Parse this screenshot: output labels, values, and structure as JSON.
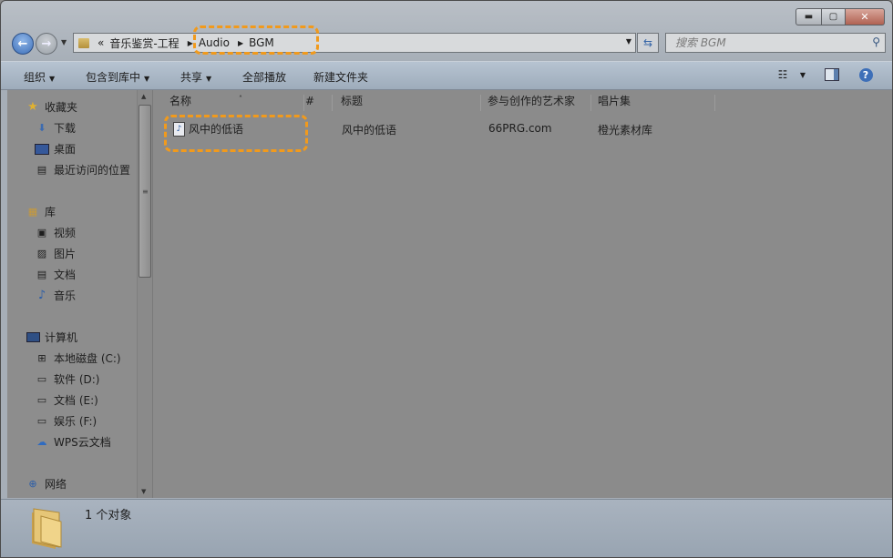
{
  "window": {
    "controls": {
      "minimize": "▬",
      "maximize": "▢",
      "close": "✕"
    }
  },
  "address": {
    "overflow": "«",
    "crumbs": [
      "音乐鉴赏-工程",
      "Audio",
      "BGM"
    ]
  },
  "search": {
    "placeholder": "搜索 BGM"
  },
  "toolbar": {
    "organize": "组织",
    "include_in_library": "包含到库中",
    "share": "共享",
    "play_all": "全部播放",
    "new_folder": "新建文件夹",
    "icons": [
      "view-options-icon",
      "preview-pane-icon",
      "help-icon"
    ]
  },
  "sidebar": {
    "favorites": {
      "label": "收藏夹",
      "items": [
        "下载",
        "桌面",
        "最近访问的位置"
      ]
    },
    "libraries": {
      "label": "库",
      "items": [
        "视频",
        "图片",
        "文档",
        "音乐"
      ]
    },
    "computer": {
      "label": "计算机",
      "items": [
        "本地磁盘 (C:)",
        "软件 (D:)",
        "文档 (E:)",
        "娱乐 (F:)",
        "WPS云文档"
      ]
    },
    "network": {
      "label": "网络"
    }
  },
  "file_list": {
    "columns": [
      "名称",
      "#",
      "标题",
      "参与创作的艺术家",
      "唱片集"
    ],
    "rows": [
      {
        "name": "风中的低语",
        "number": "",
        "title": "风中的低语",
        "artist": "66PRG.com",
        "album": "橙光素材库"
      }
    ]
  },
  "status": {
    "count": "1 个对象"
  },
  "colors": {
    "highlight": "#f19a1c"
  }
}
